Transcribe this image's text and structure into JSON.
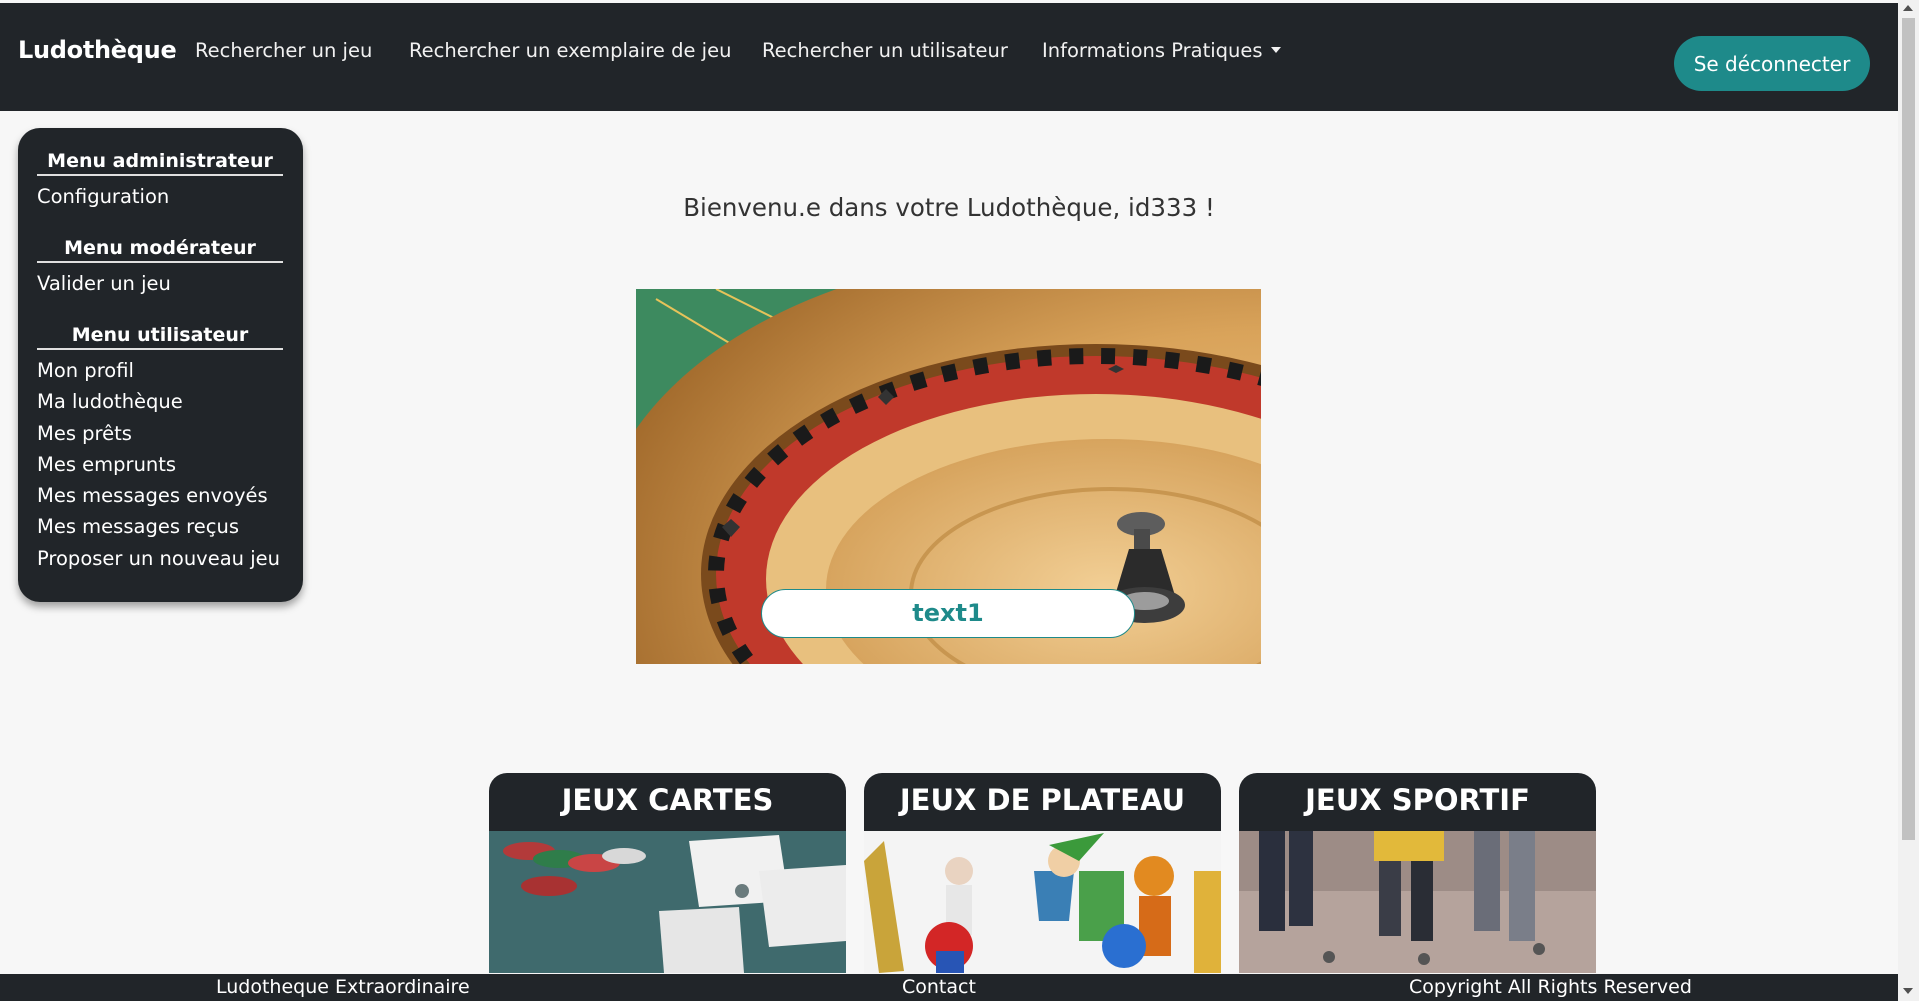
{
  "navbar": {
    "brand": "Ludothèque",
    "links": [
      "Rechercher un jeu",
      "Rechercher un exemplaire de jeu",
      "Rechercher un utilisateur",
      "Informations Pratiques"
    ],
    "logout_label": "Se déconnecter"
  },
  "sidebar": {
    "admin_title": "Menu administrateur",
    "admin_items": [
      "Configuration"
    ],
    "mod_title": "Menu modérateur",
    "mod_items": [
      "Valider un jeu"
    ],
    "user_title": "Menu utilisateur",
    "user_items": [
      "Mon profil",
      "Ma ludothèque",
      "Mes prêts",
      "Mes emprunts",
      "Mes messages envoyés",
      "Mes messages reçus",
      "Proposer un nouveau jeu"
    ]
  },
  "main": {
    "welcome": "Bienvenu.e dans votre Ludothèque, id333 !",
    "hero_button": "text1"
  },
  "categories": [
    "JEUX CARTES",
    "JEUX DE PLATEAU",
    "JEUX SPORTIF"
  ],
  "footer": {
    "left": "Ludotheque Extraordinaire",
    "center": "Contact",
    "right": "Copyright All Rights Reserved"
  },
  "colors": {
    "dark": "#212529",
    "accent": "#1e8a8a",
    "background": "#f7f7f7"
  }
}
